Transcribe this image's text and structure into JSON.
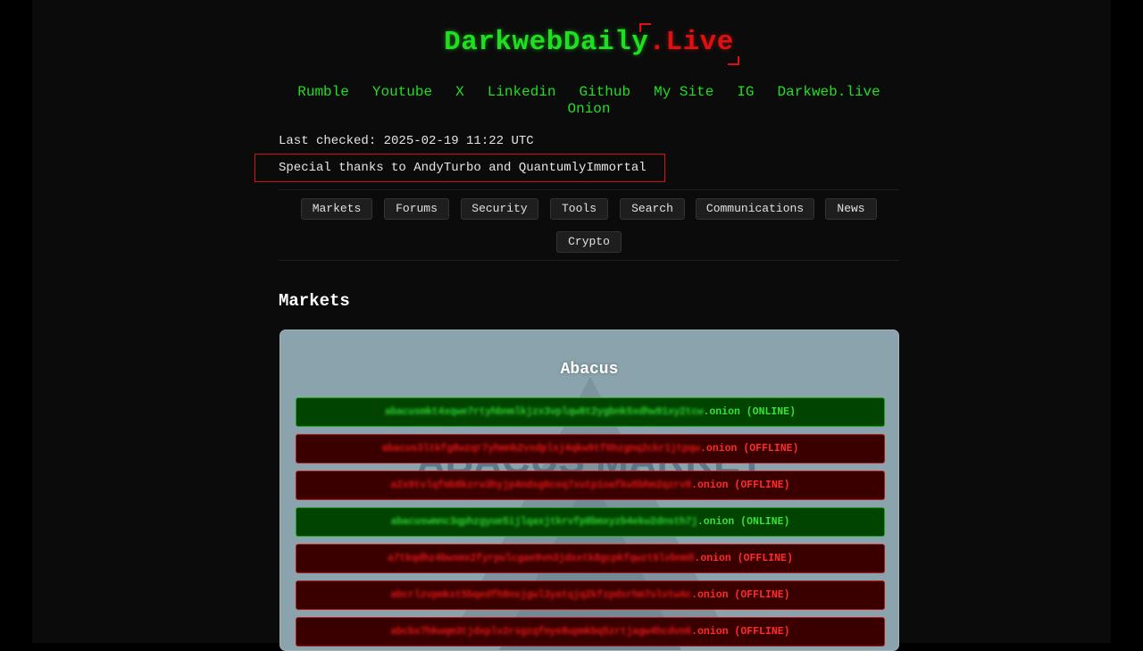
{
  "brand": {
    "part1": "DarkwebDaily",
    "part2": ".Live"
  },
  "social": {
    "row1": [
      "Rumble",
      "Youtube",
      "X",
      "Linkedin",
      "Github",
      "My Site",
      "IG",
      "Darkweb.live"
    ],
    "row2": [
      "Onion"
    ]
  },
  "status": {
    "last_checked": "Last checked: 2025-02-19 11:22 UTC",
    "thanks": "Special thanks to AndyTurbo and QuantumlyImmortal"
  },
  "categories": [
    "Markets",
    "Forums",
    "Security",
    "Tools",
    "Search",
    "Communications",
    "News",
    "Crypto"
  ],
  "section": {
    "title": "Markets"
  },
  "card": {
    "title": "Abacus",
    "links": [
      {
        "address": "abacusmkt4xqwe7rtyhbnmlkjzx3vplqw8t2ygbnk5xdhw91xy2tcw",
        "suffix": ".onion (ONLINE)",
        "status": "online"
      },
      {
        "address": "abacus3ltkfg8wzqr7yhmnb2vxdplsj4qkw9tf6hzgnq2ckr1jtpqw",
        "suffix": ".onion (OFFLINE)",
        "status": "offline"
      },
      {
        "address": "a2x9tvlqfmb8kzrw3hyjp4ndsg6ceq7xutp1oafkw5bhm2qzrv8",
        "suffix": ".onion (OFFLINE)",
        "status": "offline"
      },
      {
        "address": "abacuswmnc3qphzgyue5ijlqaxjtkrvfp8bmxyzb4ekw2dnsth7j",
        "suffix": ".onion (ONLINE)",
        "status": "online"
      },
      {
        "address": "a7tkqdhz4bwsmx2fyrpulcgae9vn3jdsxtk8gcpkfqwzt6lvbnm5",
        "suffix": ".onion (OFFLINE)",
        "status": "offline"
      },
      {
        "address": "abcrlzvpmkxt5bqedfh8nsjgwl3yatqjq2kfzpdxrhm7ulvtw4c",
        "suffix": ".onion (OFFLINE)",
        "status": "offline"
      },
      {
        "address": "abcbx7hkwqm3tjdxplv2rsgzqfnye8upmkbq5zrtjagw4hcdvn6",
        "suffix": ".onion (OFFLINE)",
        "status": "offline"
      }
    ]
  }
}
